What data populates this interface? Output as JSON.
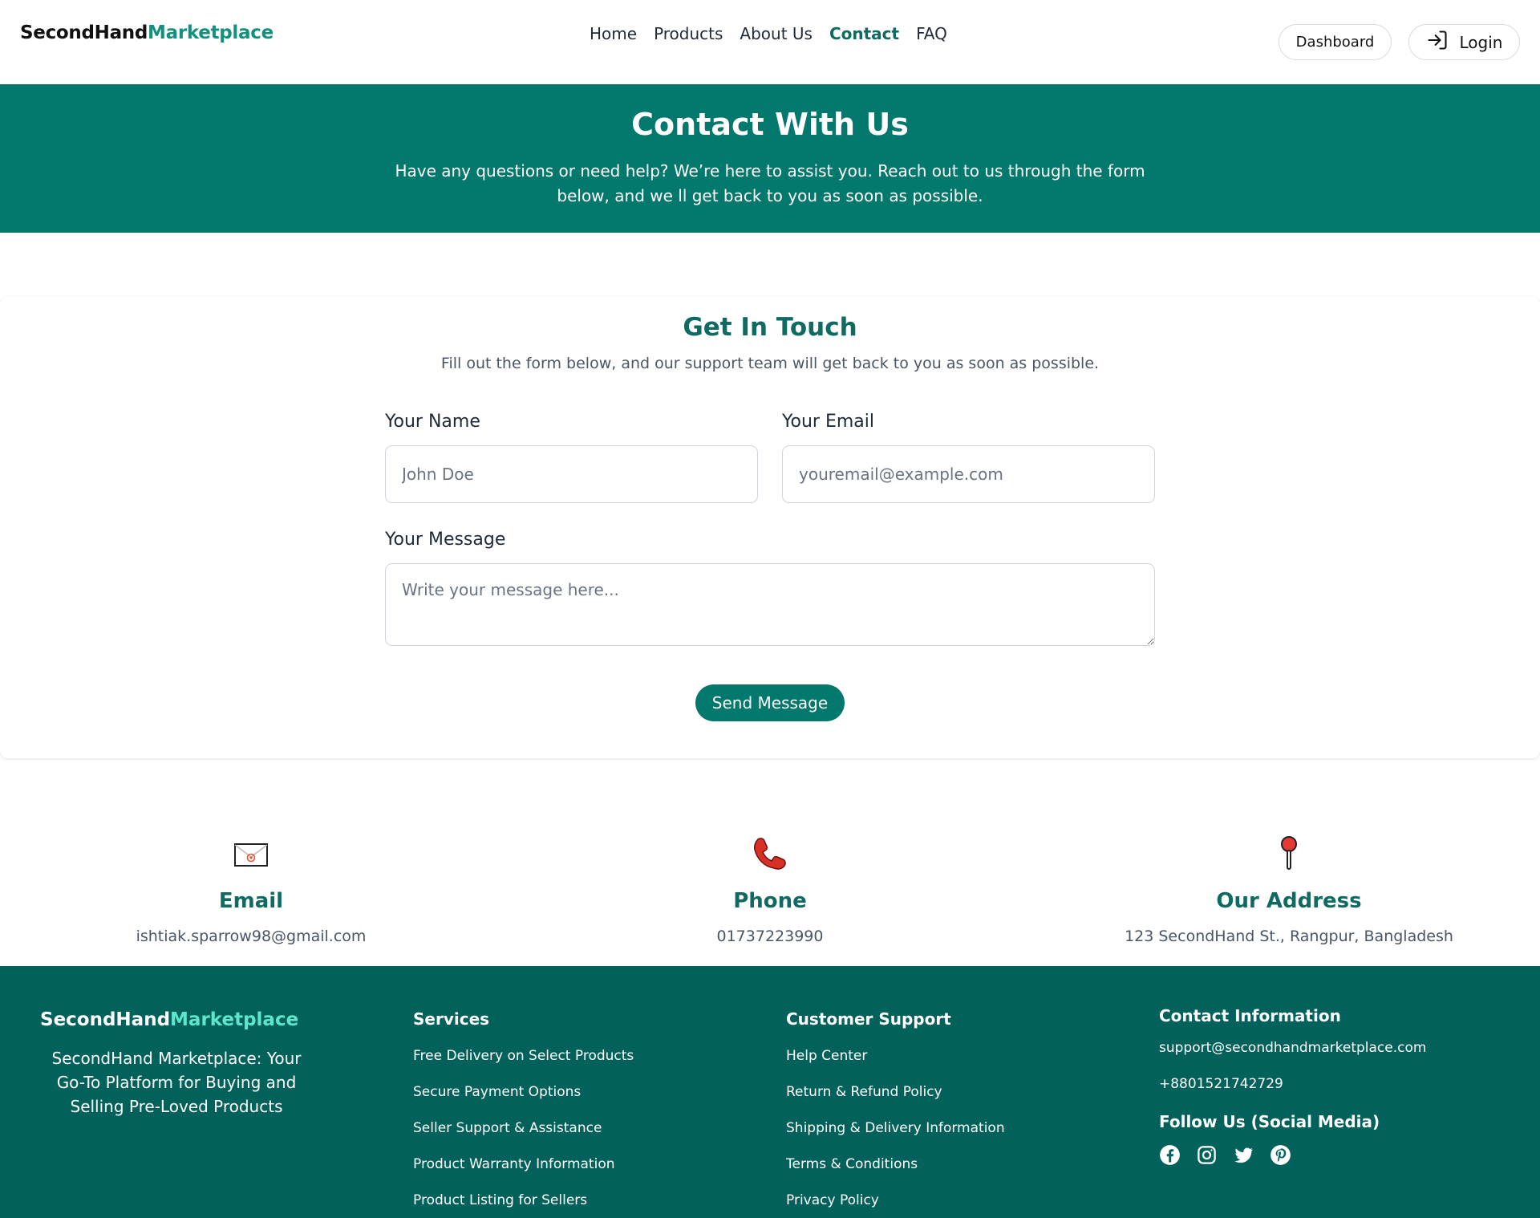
{
  "nav": {
    "logo_part1": "SecondHand",
    "logo_part2": "Marketplace",
    "links": [
      "Home",
      "Products",
      "About Us",
      "Contact",
      "FAQ"
    ],
    "dashboard_label": "Dashboard",
    "login_label": "Login"
  },
  "hero": {
    "title": "Contact With Us",
    "text": "Have any questions or need help? We’re here to assist you. Reach out to us through the form below, and we ll get back to you as soon as possible."
  },
  "form": {
    "title": "Get In Touch",
    "subtitle": "Fill out the form below, and our support team will get back to you as soon as possible.",
    "name_label": "Your Name",
    "name_placeholder": "John Doe",
    "email_label": "Your Email",
    "email_placeholder": "youremail@example.com",
    "message_label": "Your Message",
    "message_placeholder": "Write your message here...",
    "send_label": "Send Message"
  },
  "info": {
    "email_title": "Email",
    "email_value": "ishtiak.sparrow98@gmail.com",
    "phone_title": "Phone",
    "phone_value": "01737223990",
    "address_title": "Our Address",
    "address_value": "123 SecondHand St., Rangpur, Bangladesh"
  },
  "footer": {
    "logo_part1": "SecondHand",
    "logo_part2": "Marketplace",
    "tagline": "SecondHand Marketplace: Your Go-To Platform for Buying and Selling Pre-Loved Products",
    "services_title": "Services",
    "services": [
      "Free Delivery on Select Products",
      "Secure Payment Options",
      "Seller Support & Assistance",
      "Product Warranty Information",
      "Product Listing for Sellers"
    ],
    "support_title": "Customer Support",
    "support": [
      "Help Center",
      "Return & Refund Policy",
      "Shipping & Delivery Information",
      "Terms & Conditions",
      "Privacy Policy"
    ],
    "contact_title": "Contact Information",
    "contact_email": "support@secondhandmarketplace.com",
    "contact_phone": "+8801521742729",
    "social_title": "Follow Us (Social Media)",
    "social_icons": [
      "facebook-icon",
      "instagram-icon",
      "twitter-icon",
      "pinterest-icon"
    ]
  },
  "colors": {
    "brand": "#03786d",
    "brand_dark": "#02625b",
    "heading": "#0f6b62",
    "accent": "#14917e"
  }
}
